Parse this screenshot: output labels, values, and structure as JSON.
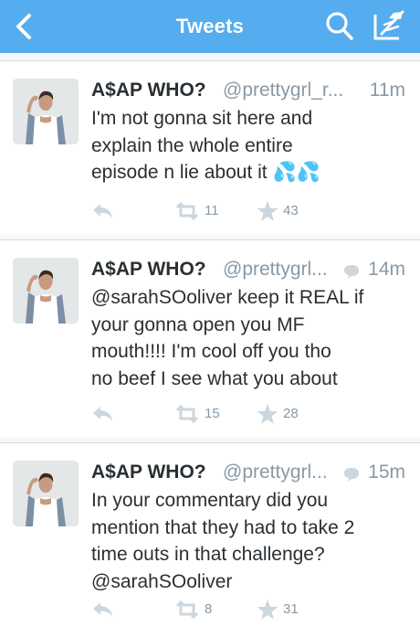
{
  "header": {
    "title": "Tweets",
    "back_icon": "back-chevron-icon",
    "search_icon": "search-icon",
    "compose_icon": "compose-quill-icon"
  },
  "colors": {
    "bar": "#55acee",
    "name": "#292f33",
    "meta": "#8899a6",
    "action": "#ccd6dd"
  },
  "tweets": [
    {
      "name": "A$AP WHO?",
      "handle": "@prettygrl_r...",
      "time": "11m",
      "has_conversation_icon": false,
      "lines": [
        "I'm not gonna sit here and",
        "explain the whole entire",
        "episode n lie about it 💦💦"
      ],
      "retweets": "11",
      "favorites": "43"
    },
    {
      "name": "A$AP WHO?",
      "handle": "@prettygrl...",
      "time": "14m",
      "has_conversation_icon": true,
      "lines": [
        "@sarahSOoliver keep it REAL if",
        "your gonna open you MF",
        "mouth!!!! I'm cool off you tho",
        "no beef I see what you about"
      ],
      "retweets": "15",
      "favorites": "28"
    },
    {
      "name": "A$AP WHO?",
      "handle": "@prettygrl...",
      "time": "15m",
      "has_conversation_icon": true,
      "lines": [
        "In your commentary did you",
        "mention that they had to take 2",
        "time outs in that challenge?",
        "@sarahSOoliver"
      ],
      "retweets": "8",
      "favorites": "31"
    }
  ]
}
